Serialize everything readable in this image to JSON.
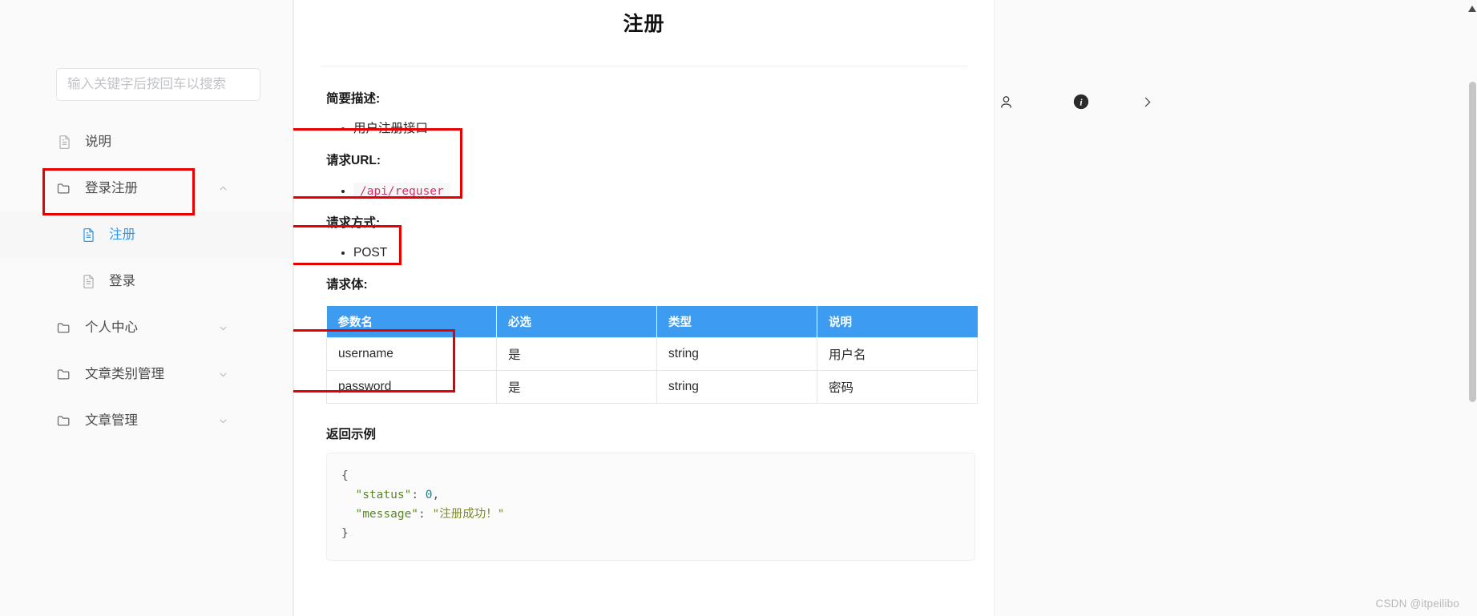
{
  "sidebar": {
    "search": {
      "placeholder": "输入关键字后按回车以搜索",
      "value": ""
    },
    "items": [
      {
        "label": "说明",
        "icon": "file-icon",
        "level": "top",
        "expandable": false,
        "chevron": ""
      },
      {
        "label": "登录注册",
        "icon": "folder-icon",
        "level": "top",
        "expandable": true,
        "chevron": "chevron-up-icon"
      },
      {
        "label": "注册",
        "icon": "file-icon",
        "level": "child",
        "expandable": false,
        "chevron": "",
        "active": true
      },
      {
        "label": "登录",
        "icon": "file-icon",
        "level": "child",
        "expandable": false,
        "chevron": ""
      },
      {
        "label": "个人中心",
        "icon": "folder-icon",
        "level": "top",
        "expandable": true,
        "chevron": "chevron-down-icon"
      },
      {
        "label": "文章类别管理",
        "icon": "folder-icon",
        "level": "top",
        "expandable": true,
        "chevron": "chevron-down-icon"
      },
      {
        "label": "文章管理",
        "icon": "folder-icon",
        "level": "top",
        "expandable": true,
        "chevron": "chevron-down-icon"
      }
    ]
  },
  "doc": {
    "title": "注册",
    "sections": {
      "summary_label": "简要描述:",
      "summary_item": "用户注册接口",
      "url_label": "请求URL:",
      "url_value": "/api/reguser",
      "method_label": "请求方式:",
      "method_value": "POST",
      "body_label": "请求体:",
      "return_label": "返回示例"
    },
    "table": {
      "headers": [
        "参数名",
        "必选",
        "类型",
        "说明"
      ],
      "rows": [
        [
          "username",
          "是",
          "string",
          "用户名"
        ],
        [
          "password",
          "是",
          "string",
          "密码"
        ]
      ]
    },
    "code": {
      "line1": "{",
      "line2_key": "\"status\"",
      "line2_sep": ": ",
      "line2_val": "0",
      "line2_end": ",",
      "line3_key": "\"message\"",
      "line3_sep": ": ",
      "line3_val": "\"注册成功！\"",
      "line4": "}"
    }
  },
  "right_panel": {
    "icons": [
      {
        "name": "user-icon",
        "label": "user"
      },
      {
        "name": "info-icon",
        "label": "info"
      },
      {
        "name": "chevron-right-icon",
        "label": "next"
      }
    ]
  },
  "watermark": "CSDN @itpeilibo",
  "colors": {
    "table_header_bg": "#3d9bf0",
    "active_nav": "#2e9bf0",
    "annotation_red": "#e60000",
    "code_string": "#d6336c"
  }
}
